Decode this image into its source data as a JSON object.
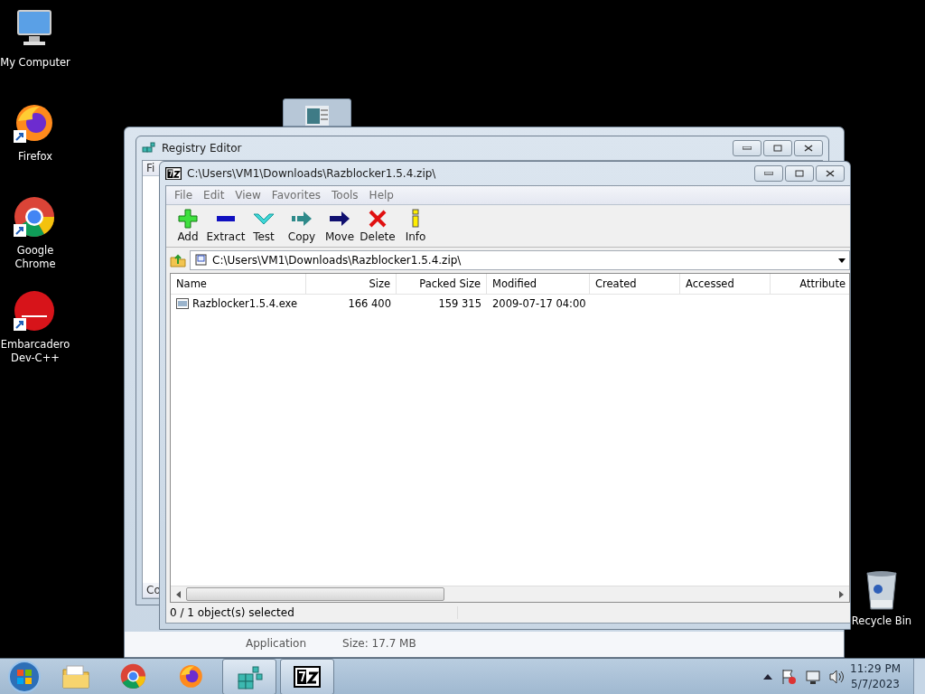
{
  "desktop_icons": [
    {
      "kind": "computer",
      "label": "My Computer",
      "shortcut": false
    },
    {
      "kind": "firefox",
      "label": "Firefox",
      "shortcut": true
    },
    {
      "kind": "chrome",
      "label": "Google Chrome",
      "shortcut": true
    },
    {
      "kind": "devcpp",
      "label": "Embarcadero Dev-C++",
      "shortcut": true
    }
  ],
  "recycle_bin": {
    "label": "Recycle Bin"
  },
  "back_window": {
    "item_type": "Application",
    "item_size": "Size: 17.7 MB"
  },
  "registry_window": {
    "title": "Registry Editor",
    "menu_fragment": "Fi",
    "status_fragment": "Co"
  },
  "archive_window": {
    "title": "C:\\Users\\VM1\\Downloads\\Razblocker1.5.4.zip\\",
    "menu": [
      "File",
      "Edit",
      "View",
      "Favorites",
      "Tools",
      "Help"
    ],
    "toolbar": [
      {
        "kind": "add",
        "label": "Add"
      },
      {
        "kind": "extract",
        "label": "Extract"
      },
      {
        "kind": "test",
        "label": "Test"
      },
      {
        "kind": "copy",
        "label": "Copy"
      },
      {
        "kind": "move",
        "label": "Move"
      },
      {
        "kind": "delete",
        "label": "Delete"
      },
      {
        "kind": "info",
        "label": "Info"
      }
    ],
    "address": "C:\\Users\\VM1\\Downloads\\Razblocker1.5.4.zip\\",
    "columns": [
      "Name",
      "Size",
      "Packed Size",
      "Modified",
      "Created",
      "Accessed",
      "Attribute"
    ],
    "rows": [
      {
        "selected": false,
        "cells": [
          "Razblocker1.5.4.exe",
          "166 400",
          "159 315",
          "2009-07-17 04:00",
          "",
          "",
          ""
        ]
      }
    ],
    "status": "0 / 1 object(s) selected"
  },
  "taskbar": {
    "items": [
      {
        "kind": "explorer",
        "active": false
      },
      {
        "kind": "chrome",
        "active": false
      },
      {
        "kind": "firefox",
        "active": false
      },
      {
        "kind": "registry",
        "active": true
      },
      {
        "kind": "sevenzip",
        "active": true
      }
    ],
    "time": "11:29 PM",
    "date": "5/7/2023"
  }
}
